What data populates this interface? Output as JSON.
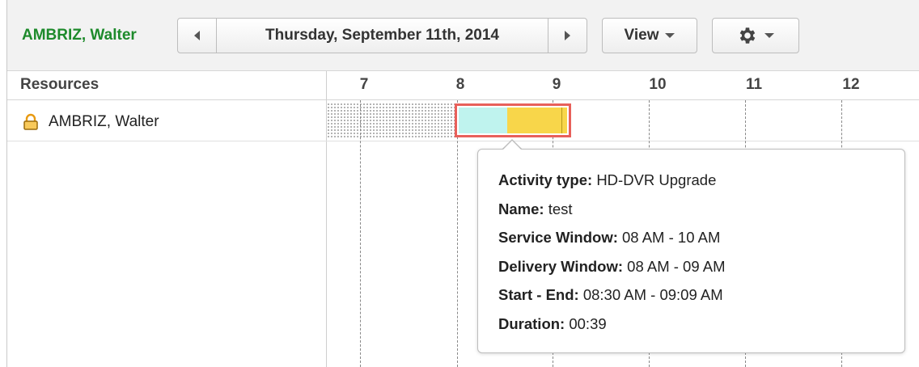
{
  "toolbar": {
    "resource_name": "AMBRIZ, Walter",
    "date_label": "Thursday, September 11th, 2014",
    "view_label": "View"
  },
  "grid": {
    "resources_header": "Resources",
    "hours": [
      "7",
      "8",
      "9",
      "10",
      "11",
      "12"
    ],
    "resource_rows": [
      {
        "name": "AMBRIZ, Walter",
        "icon": "lock-icon"
      }
    ]
  },
  "tooltip": {
    "activity_type_label": "Activity type:",
    "activity_type_value": "HD-DVR Upgrade",
    "name_label": "Name:",
    "name_value": "test",
    "service_window_label": "Service Window:",
    "service_window_value": "08 AM - 10 AM",
    "delivery_window_label": "Delivery Window:",
    "delivery_window_value": "08 AM - 09 AM",
    "start_end_label": "Start - End:",
    "start_end_value": "08:30 AM - 09:09 AM",
    "duration_label": "Duration:",
    "duration_value": "00:39"
  },
  "colors": {
    "resource_name": "#1d8a2b",
    "activity_border": "#e8605a",
    "travel_segment": "#bff3ee",
    "work_segment": "#f8d64a",
    "lock_icon": "#f0a31a"
  }
}
